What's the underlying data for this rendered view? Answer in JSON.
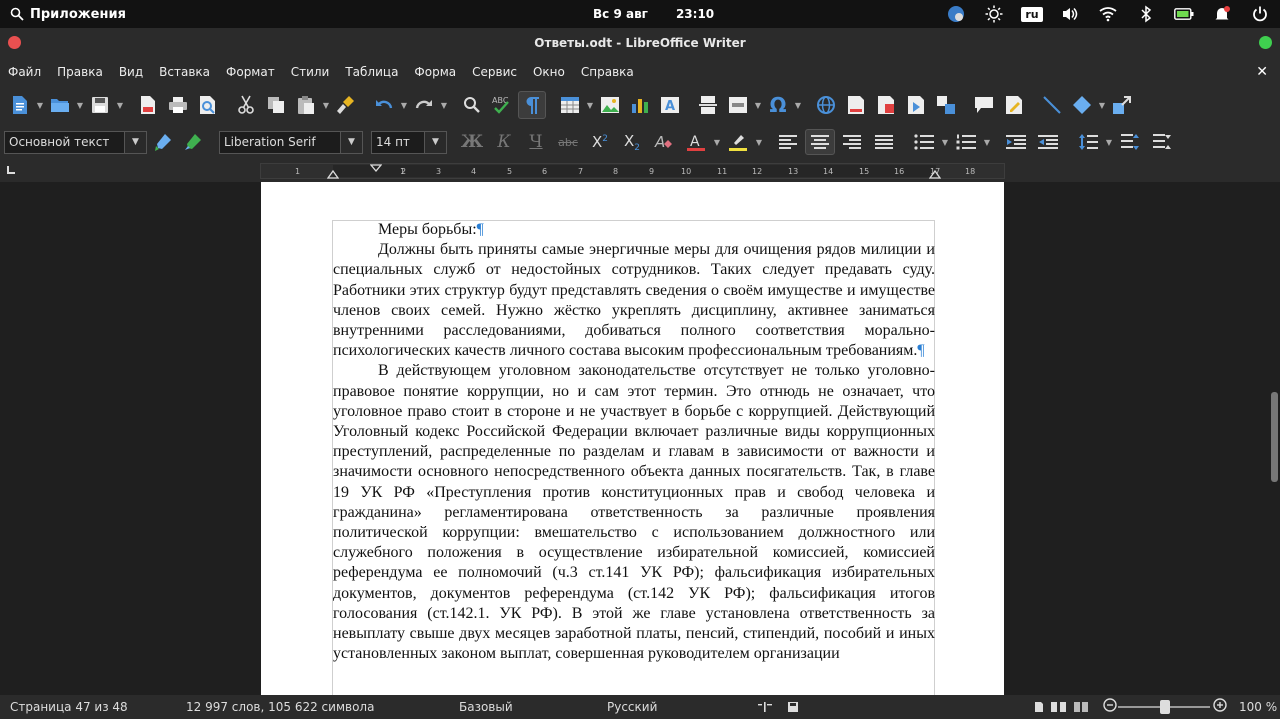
{
  "system_panel": {
    "apps_label": "Приложения",
    "day": "Вс",
    "date": "9 авг",
    "time": "23:10",
    "keyboard_layout": "ru"
  },
  "window": {
    "title": "Ответы.odt - LibreOffice Writer"
  },
  "menu": {
    "items": [
      "Файл",
      "Правка",
      "Вид",
      "Вставка",
      "Формат",
      "Стили",
      "Таблица",
      "Форма",
      "Сервис",
      "Окно",
      "Справка"
    ],
    "close_glyph": "✕"
  },
  "formatting": {
    "paragraph_style": "Основной текст",
    "font_name": "Liberation Serif",
    "font_size": "14 пт"
  },
  "ruler": {
    "ticks": [
      "1",
      "1",
      "2",
      "3",
      "4",
      "5",
      "6",
      "7",
      "8",
      "9",
      "10",
      "11",
      "12",
      "13",
      "14",
      "15",
      "16",
      "17",
      "18"
    ]
  },
  "document": {
    "paragraphs": [
      "Меры борьбы:",
      "Должны быть приняты самые энергичные меры для очищения рядов милиции и специальных служб от недостойных сотрудников. Таких следует предавать суду. Работники этих структур будут представлять сведения о своём имуществе и имуществе членов своих семей. Нужно жёстко укреплять дисциплину, активнее заниматься внутренними расследованиями, добиваться полного соответствия морально-психологических качеств личного состава высоким профессиональным требованиям.",
      "В действующем уголовном законодательстве отсутствует не только уголовно-правовое понятие коррупции, но и сам этот термин. Это отнюдь не означает, что уголовное право стоит в стороне и не участвует в борьбе с коррупцией. Действующий Уголовный кодекс Российской Федерации включает различные виды коррупционных преступлений, распределенные по разделам и главам в зависимости от важности и значимости основного непосредственного объекта данных посягательств. Так, в главе 19 УК РФ «Преступления против конституционных прав и свобод человека и гражданина» регламентирована ответственность за различные проявления политической коррупции: вмешательство с использованием должностного или служебного положения в осуществление избирательной комиссией, комиссией референдума ее полномочий (ч.3 ст.141 УК РФ); фальсификация избирательных документов, документов референдума (ст.142 УК РФ); фальсификация итогов голосования (ст.142.1. УК РФ). В этой же главе установлена ответственность за невыплату свыше двух месяцев заработной платы, пенсий, стипендий, пособий и иных установленных законом выплат, совершенная руководителем организации"
    ]
  },
  "status": {
    "page": "Страница 47 из 48",
    "words": "12 997 слов, 105 622 символа",
    "page_style": "Базовый",
    "language": "Русский",
    "zoom": "100 %",
    "zoom_level_percent": 100
  }
}
